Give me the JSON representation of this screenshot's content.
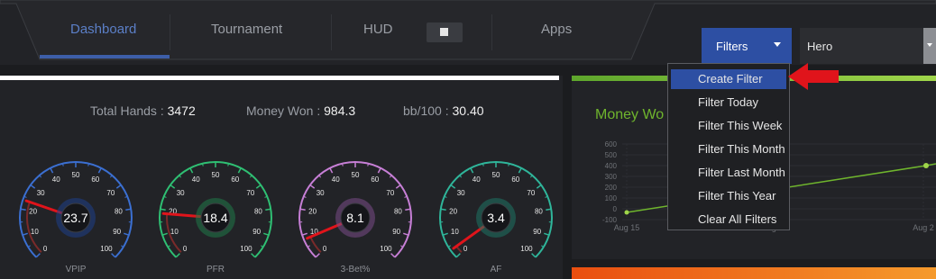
{
  "nav": {
    "tabs": [
      {
        "label": "Dashboard",
        "active": true
      },
      {
        "label": "Tournament",
        "active": false
      },
      {
        "label": "HUD",
        "active": false
      },
      {
        "label": "Apps",
        "active": false
      }
    ],
    "hud_toggle": "off"
  },
  "filters": {
    "button_label": "Filters",
    "player_select": "Hero",
    "menu": [
      "Create Filter",
      "Filter Today",
      "Filter This Week",
      "Filter This Month",
      "Filter Last Month",
      "Filter This Year",
      "Clear All Filters"
    ],
    "highlighted": "Create Filter"
  },
  "stats": {
    "total_hands_label": "Total Hands :",
    "total_hands": "3472",
    "money_won_label": "Money Won :",
    "money_won": "984.3",
    "bb100_label": "bb/100 :",
    "bb100": "30.40"
  },
  "gauges": [
    {
      "name": "VPIP",
      "value": "23.7",
      "level": 23.7,
      "color": "#3b6fd1",
      "glow": "#1e3f8a"
    },
    {
      "name": "PFR",
      "value": "18.4",
      "level": 18.4,
      "color": "#2fbf73",
      "glow": "#1f7a48"
    },
    {
      "name": "3-Bet%",
      "value": "8.1",
      "level": 8.1,
      "color": "#c77fd6",
      "glow": "#7a4c88"
    },
    {
      "name": "AF",
      "value": "3.4",
      "level": 3.4,
      "color": "#2fb59a",
      "glow": "#1e7564"
    }
  ],
  "gauge_ticks": [
    "0",
    "10",
    "20",
    "30",
    "40",
    "50",
    "60",
    "70",
    "80",
    "90",
    "100"
  ],
  "money_panel": {
    "title": "Money Wo",
    "y_ticks": [
      "600",
      "500",
      "400",
      "300",
      "200",
      "100",
      "0",
      "-100"
    ],
    "x_ticks": [
      "Aug 15",
      "Aug 22",
      "Aug 2"
    ]
  },
  "colors": {
    "accent": "#2d4fa3",
    "money_green": "#6fb52d",
    "arrow_red": "#e0141b"
  }
}
